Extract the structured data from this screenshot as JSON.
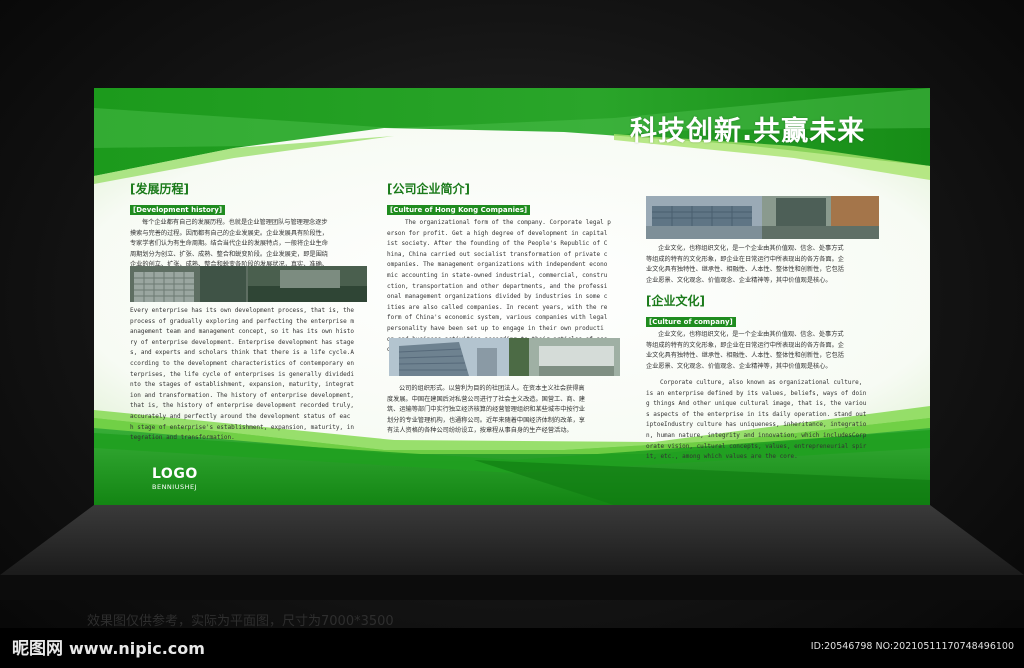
{
  "slogan": "科技创新.共赢未来",
  "left": {
    "title": "[发展历程]",
    "tag": "[Development history]",
    "cn_text": "每个企业都有自己的发展历程。也就是企业管理团队与管理理念逐步\n摸索与完善的过程。因而都有自己的企业发展史。企业发展具有阶段性，\n专家学者们认为有生命周期。结合当代企业的发展特点，一般将企业生命\n周期划分为创立、扩张、成熟、整合和蜕变阶段。企业发展史，即是围绕\n企业的创立、扩张、成熟、整合和蜕变各阶段的发展状况，真实、准确、\n完善地记录下来的企业发展史册。",
    "en_text": "Every enterprise has its own development process, that is, the\nprocess of gradually exploring and perfecting the enterprise m\nanagement team and management concept, so it has its own histo\nry of enterprise development. Enterprise development has stage\ns, and experts and scholars think that there is a life cycle.A\nccording to the development characteristics of contemporary en\nterprises, the life cycle of enterprises is generally dividedi\nnto the stages of establishment, expansion, maturity, integrat\nion and transformation. The history of enterprise development,\nthat is, the history of enterprise development recorded truly,\n accurately and perfectly around the development status of eac\nh stage of enterprise's establishment, expansion, maturity, in\ntegration and transformation."
  },
  "middle": {
    "title": "[公司企业简介]",
    "tag": "[Culture of Hong Kong Companies]",
    "en_text": "The organizational form of the company. Corporate legal p\nerson for profit. Get a high degree of development in capital\nist society. After the founding of the People's Republic of C\nhina, China carried out socialist transformation of private c\nompanies. The management organizations with independent econo\nmic accounting in state-owned industrial, commercial, constru\nction, transportation and other departments, and the professi\nonal management organizations divided by industries in some c\nities are also called companies. In recent years, with the re\nform of China's economic system, various companies with legal\n personality have been set up to engage in their own producti\non and business activities according to their articles of ass\nociation.",
    "cn_text": "公司的组织形式。以营利为目的的社团法人。在资本主义社会获得高\n度发展。中国在建国后对私营公司进行了社会主义改造。国营工、商、建\n筑、运输等部门中实行独立经济核算的经营管理组织和某些城市中按行业\n划分的专业管理机构，也通称公司。近年来随着中国经济体制的改革，享\n有法人资格的各种公司纷纷设立，按章程从事自身的生产经营活动。"
  },
  "right": {
    "cn_text_1": "企业文化，也称组织文化，是一个企业由其价值观、信念、处事方式\n等组成的特有的文化形象，即企业在日常运行中所表现出的各方各面。企\n业文化具有独特性、继承性、相融性、人本性、整体性和创新性，它包括\n企业愿景、文化观念、价值观念、企业精神等，其中价值观是核心。",
    "title": "[企业文化]",
    "tag": "[Culture of company]",
    "cn_text_2": "企业文化，也称组织文化，是一个企业由其价值观、信念、处事方式\n等组成的特有的文化形象，即企业在日常运行中所表现出的各方各面。企\n业文化具有独特性、继承性、相融性、人本性、整体性和创新性，它包括\n企业愿景、文化观念、价值观念、企业精神等，其中价值观是核心。",
    "en_text": "Corporate culture, also known as organizational culture,\nis an enterprise defined by its values, beliefs, ways of doin\ng things And other unique cultural image, that is, the variou\ns aspects of the enterprise in its daily operation. stand out\niptoeIndustry culture has uniqueness, inheritance, integratio\nn, human nature, integrity and innovation, which includesCorp\norate vision, cultural concepts, values, entrepreneurial spir\nit, etc., among which values are the core."
  },
  "logo": {
    "main": "LOGO",
    "sub": "BENNIUSHEJ"
  },
  "caption": "效果图仅供参考，实际为平面图，尺寸为7000*3500",
  "watermark": {
    "brand": "昵图网",
    "url": "www.nipic.com",
    "id": "ID:20546798 NO:20210511170748496100"
  },
  "colors": {
    "green_dark": "#0f7a10",
    "green_mid": "#2aa52a",
    "green_light": "#7fd84a",
    "panel": "#ffffff"
  }
}
